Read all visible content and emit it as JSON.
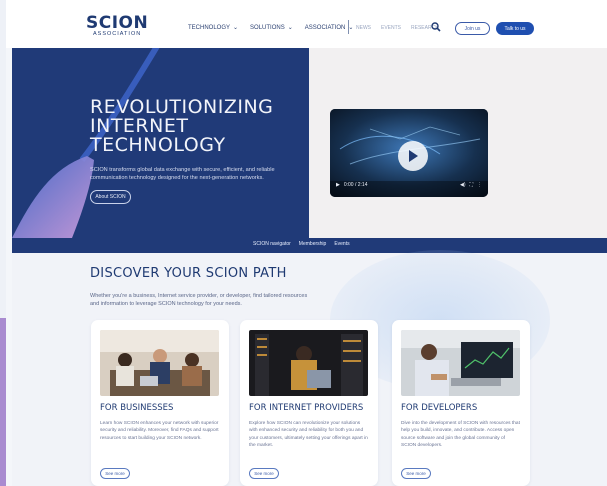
{
  "header": {
    "logo_main": "SCION",
    "logo_sub": "ASSOCIATION",
    "nav": [
      {
        "label": "TECHNOLOGY"
      },
      {
        "label": "SOLUTIONS"
      },
      {
        "label": "ASSOCIATION"
      }
    ],
    "subnav": [
      "NEWS",
      "EVENTS",
      "RESEARCH"
    ],
    "join_label": "Join us",
    "talk_label": "Talk to us"
  },
  "hero": {
    "title_line1": "REVOLUTIONIZING",
    "title_line2": "INTERNET",
    "title_line3": "TECHNOLOGY",
    "description": "SCION transforms global data exchange with secure, efficient, and reliable communication technology designed for the next-generation networks.",
    "about_label": "About SCION"
  },
  "video": {
    "time": "0:00 / 2:14"
  },
  "bar": {
    "items": [
      "SCION navigator",
      "Membership",
      "Events"
    ]
  },
  "discover": {
    "title": "DISCOVER YOUR SCION PATH",
    "description": "Whether you're a business, Internet service provider, or developer, find tailored resources and information to leverage SCION technology for your needs."
  },
  "cards": [
    {
      "title": "FOR BUSINESSES",
      "text": "Learn how SCION enhances your network with superior security and reliability. Moreover, find FAQs and support resources to start building your SCION network.",
      "button": "See more"
    },
    {
      "title": "FOR INTERNET PROVIDERS",
      "text": "Explore how SCION can revolutionize your solutions with enhanced security and reliability for both you and your customers, ultimately setting your offerings apart in the market.",
      "button": "See more"
    },
    {
      "title": "FOR DEVELOPERS",
      "text": "Dive into the development of SCION with resources that help you build, innovate, and contribute. Access open source software and join the global community of SCION developers.",
      "button": "See more"
    }
  ],
  "colors": {
    "brand_navy": "#203a78",
    "accent_blue": "#1f4fb0",
    "accent_purple": "#a98bd0"
  }
}
